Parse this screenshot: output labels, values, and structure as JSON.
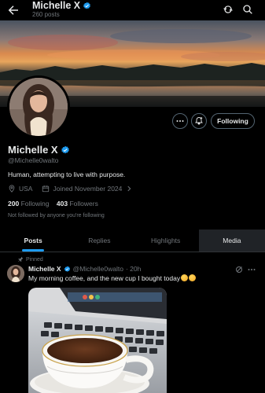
{
  "header": {
    "title": "Michelle X",
    "posts_count": "260 posts"
  },
  "profile": {
    "name": "Michelle X",
    "handle": "@Michelle0walto",
    "bio": "Human, attempting to live with purpose.",
    "location": "USA",
    "joined": "Joined November 2024",
    "following_count": "200",
    "following_label": "Following",
    "followers_count": "403",
    "followers_label": "Followers",
    "not_followed_text": "Not followed by anyone you're following",
    "follow_button_label": "Following"
  },
  "tabs": [
    {
      "label": "Posts"
    },
    {
      "label": "Replies"
    },
    {
      "label": "Highlights"
    },
    {
      "label": "Media"
    }
  ],
  "post": {
    "pinned_label": "Pinned",
    "author_name": "Michelle X",
    "author_handle": "@Michelle0walto",
    "time": "· 20h",
    "text": "My morning coffee, and the new cup I bought today"
  },
  "icons": [
    "back-arrow-icon",
    "verified-badge-icon",
    "refresh-icon",
    "search-icon",
    "more-icon",
    "notification-add-icon",
    "location-icon",
    "calendar-icon",
    "chevron-right-icon",
    "pin-icon",
    "grok-icon"
  ],
  "colors": {
    "background": "#000000",
    "accent": "#1d9bf0",
    "text_primary": "#e7e9ea",
    "text_secondary": "#71767b",
    "border": "#2f3336"
  }
}
